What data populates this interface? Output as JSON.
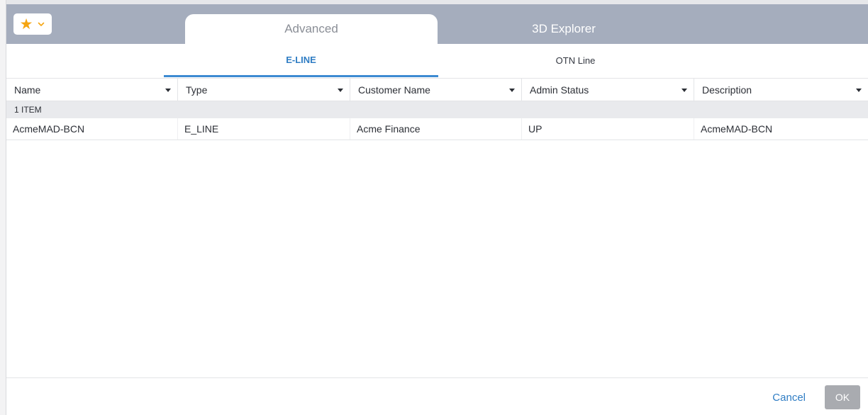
{
  "header": {
    "favorites_icon": "star-icon",
    "favorites_dropdown_icon": "chevron-down-icon",
    "tabs": [
      {
        "label": "Advanced",
        "active": true
      },
      {
        "label": "3D Explorer",
        "active": false
      }
    ]
  },
  "sub_tabs": [
    {
      "label": "E-LINE",
      "active": true
    },
    {
      "label": "OTN Line",
      "active": false
    }
  ],
  "table": {
    "columns": [
      "Name",
      "Type",
      "Customer Name",
      "Admin Status",
      "Description"
    ],
    "group_label": "1 ITEM",
    "rows": [
      [
        "AcmeMAD-BCN",
        "E_LINE",
        "Acme Finance",
        "UP",
        "AcmeMAD-BCN"
      ]
    ]
  },
  "footer": {
    "cancel_label": "Cancel",
    "ok_label": "OK"
  },
  "colors": {
    "header_bg": "#a5adbd",
    "accent": "#2f7dc4",
    "star": "#f5a512",
    "ok_disabled": "#a9abb0"
  }
}
